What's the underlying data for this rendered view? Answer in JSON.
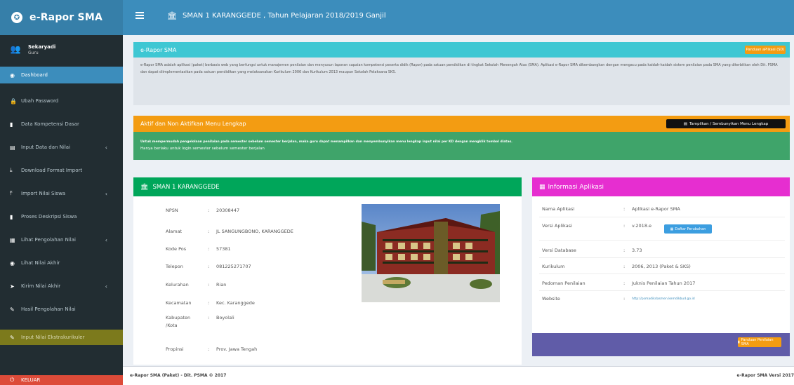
{
  "app": {
    "name": "e-Rapor SMA"
  },
  "header": {
    "school_title": "SMAN 1 KARANGGEDE , Tahun Pelajaran 2018/2019 Ganjil"
  },
  "user": {
    "name": "Sekaryadi",
    "role": "Guru"
  },
  "sidebar": {
    "items": [
      {
        "label": "Dashboard",
        "icon": "dashboard-icon"
      },
      {
        "label": "Ubah Password",
        "icon": "lock-icon"
      },
      {
        "label": "Data Kompetensi Dasar",
        "icon": "book-icon"
      },
      {
        "label": "Input Data dan Nilai",
        "icon": "edit-icon"
      },
      {
        "label": "Download Format Import",
        "icon": "download-icon"
      },
      {
        "label": "Import Nilai Siswa",
        "icon": "upload-icon"
      },
      {
        "label": "Proses Deskripsi Siswa",
        "icon": "book-icon"
      },
      {
        "label": "Lihat Pengolahan Nilai",
        "icon": "table-icon"
      },
      {
        "label": "Lihat Nilai Akhir",
        "icon": "eye-icon"
      },
      {
        "label": "Kirim Nilai Akhir",
        "icon": "send-icon"
      },
      {
        "label": "Hasil Pengolahan Nilai",
        "icon": "wrench-icon"
      },
      {
        "label": "Input Nilai Ekstrakurikuler",
        "icon": "wrench-icon"
      },
      {
        "label": "KELUAR",
        "icon": "power-icon"
      }
    ]
  },
  "intro_box": {
    "title": "e-Rapor SMA",
    "button": "Panduan aPlikasi (SD)",
    "text": "e-Rapor SMA adalah aplikasi (paket) berbasis web yang berfungsi untuk manajemen penilaian dan menyusun laporan capaian kompetensi peserta didik (Rapor) pada satuan pendidikan di tingkat Sekolah Menengah Atas (SMA). Aplikasi e-Rapor SMA dikembangkan dengan mengacu pada kaidah-kaidah sistem penilaian pada SMA yang diterbitkan oleh Dit. PSMA dan dapat diimplementasikan pada satuan pendidikan yang melaksanakan Kurikulum 2006 dan Kurikulum 2013 maupun Sekolah Pelaksana SKS."
  },
  "warning_box": {
    "title": "Aktif dan Non Aktifkan Menu Lengkap",
    "button": "Tampilkan / Sembunyikan Menu Lengkap",
    "text1": "Untuk mempermudah pengelolaan penilaian pada semester sebelum semester berjalan, maka guru dapat menampilkan dan menyembunyikan menu lengkap input nilai per KD dengan mengklik tombol diatas.",
    "text2": "Hanya berlaku untuk login semester sebelum semester berjalan"
  },
  "school_box": {
    "title": "SMAN 1 KARANGGEDE",
    "fields": [
      {
        "label": "NPSN",
        "value": "20308447"
      },
      {
        "label": "Alamat",
        "value": "JL SANGUNGBONO, KARANGGEDE"
      },
      {
        "label": "Kode Pos",
        "value": "57381"
      },
      {
        "label": "Telepon",
        "value": "081225271707"
      },
      {
        "label": "Kelurahan",
        "value": "Rian"
      },
      {
        "label": "Kecamatan",
        "value": "Kec. Karanggede"
      },
      {
        "label": "Kabupaten /Kota",
        "value": "Boyolali"
      },
      {
        "label": "Propinsi",
        "value": "Prov. Jawa Tengah"
      }
    ]
  },
  "app_box": {
    "title": "Informasi Aplikasi",
    "button": "Panduan Penilaian SMA",
    "update_button": "Daftar Perubahan",
    "fields": [
      {
        "label": "Nama Aplikasi",
        "value": "Aplikasi e-Rapor SMA"
      },
      {
        "label": "Versi Aplikasi",
        "value": "v.2018.e"
      },
      {
        "label": "Versi Database",
        "value": "3.73"
      },
      {
        "label": "Kurikulum",
        "value": "2006, 2013 (Paket & SKS)"
      },
      {
        "label": "Pedoman Penilaian",
        "value": "Juknis Penilaian Tahun 2017"
      },
      {
        "label": "Website",
        "value": "http://psmadikdasmen.kemdikbud.go.id"
      }
    ]
  },
  "footer": {
    "left": "e-Rapor SMA (Paket) - Dit. PSMA © 2017",
    "right": "e-Rapor SMA Versi 2017"
  },
  "colors": {
    "topbar": "#3c8dbc",
    "sidebar": "#222d32",
    "aqua": "#3ec7d3",
    "orange": "#f39c12",
    "green": "#00a65a",
    "pink": "#e62ed0",
    "purple": "#605ca8"
  }
}
